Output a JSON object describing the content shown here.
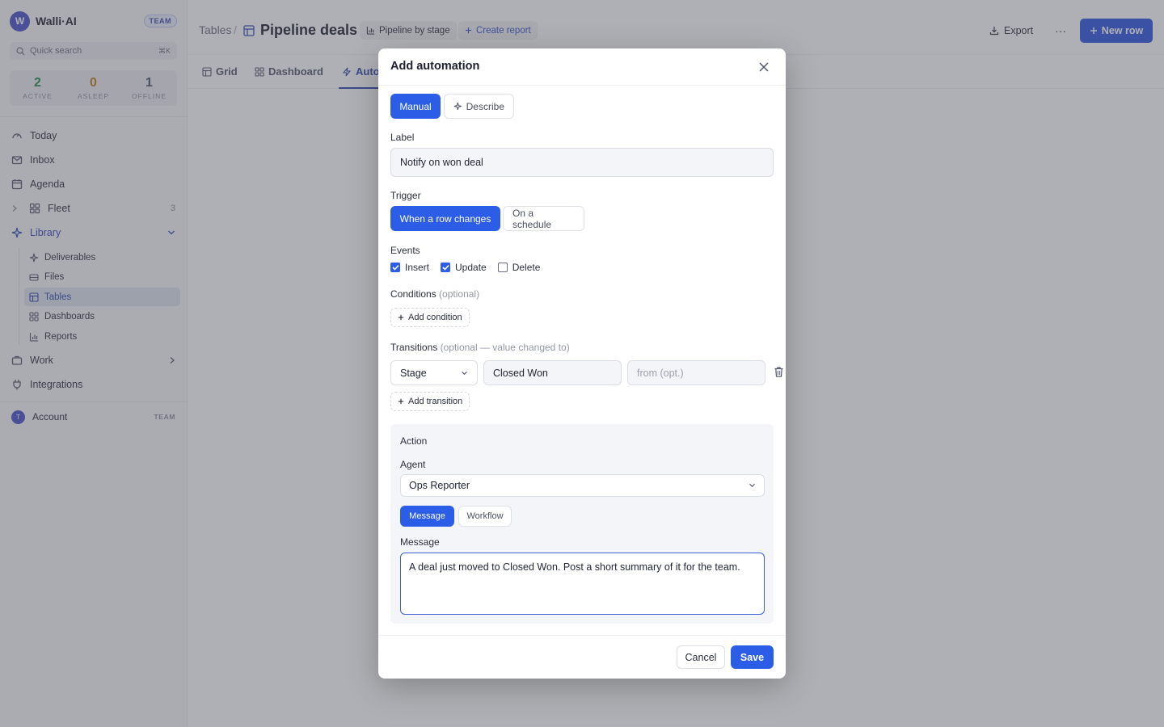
{
  "sidebar": {
    "brand": {
      "logo_letter": "W",
      "name": "Walli·AI",
      "badge": "TEAM"
    },
    "search": {
      "placeholder": "Quick search",
      "shortcut": "⌘K"
    },
    "stats": [
      {
        "value": "2",
        "label": "ACTIVE",
        "color": "#1f8a4c"
      },
      {
        "value": "0",
        "label": "ASLEEP",
        "color": "#c27a12"
      },
      {
        "value": "1",
        "label": "OFFLINE",
        "color": "#4a5063"
      }
    ],
    "nav": {
      "today": "Today",
      "inbox": "Inbox",
      "agenda": "Agenda",
      "fleet": "Fleet",
      "fleet_count": "3",
      "library": "Library",
      "work": "Work",
      "integrations": "Integrations"
    },
    "library_items": {
      "deliverables": "Deliverables",
      "files": "Files",
      "tables": "Tables",
      "dashboards": "Dashboards",
      "reports": "Reports"
    },
    "account": {
      "initial": "T",
      "label": "Account",
      "badge": "TEAM"
    }
  },
  "header": {
    "breadcrumb": "Tables",
    "separator": "/",
    "title": "Pipeline deals",
    "view_chip": "Pipeline by stage",
    "create_report": "Create report",
    "export": "Export",
    "more": "···",
    "new_row": "New row"
  },
  "tabs": [
    {
      "label": "Grid"
    },
    {
      "label": "Dashboard"
    },
    {
      "label": "Auto"
    }
  ],
  "modal": {
    "title": "Add automation",
    "mode": {
      "manual": "Manual",
      "describe": "Describe"
    },
    "label_field": {
      "label": "Label",
      "value": "Notify on won deal"
    },
    "trigger": {
      "label": "Trigger",
      "row_changes": "When a row changes",
      "schedule": "On a schedule"
    },
    "events": {
      "label": "Events",
      "insert": {
        "label": "Insert",
        "checked": true
      },
      "update": {
        "label": "Update",
        "checked": true
      },
      "delete": {
        "label": "Delete",
        "checked": false
      }
    },
    "conditions": {
      "label": "Conditions",
      "optional": "(optional)",
      "add": "Add condition"
    },
    "transitions": {
      "label": "Transitions",
      "optional": "(optional — value changed to)",
      "column": "Stage",
      "to_value": "Closed Won",
      "from_placeholder": "from (opt.)",
      "add": "Add transition"
    },
    "action": {
      "title": "Action",
      "agent_label": "Agent",
      "agent_value": "Ops Reporter",
      "type_message": "Message",
      "type_workflow": "Workflow",
      "message_label": "Message",
      "message_value": "A deal just moved to Closed Won. Post a short summary of it for the team."
    },
    "footer": {
      "cancel": "Cancel",
      "save": "Save"
    }
  },
  "colors": {
    "accent": "#2b5de6",
    "sidebar_accent": "#2f45b0",
    "overlay": "rgba(78,80,92,0.45)"
  }
}
